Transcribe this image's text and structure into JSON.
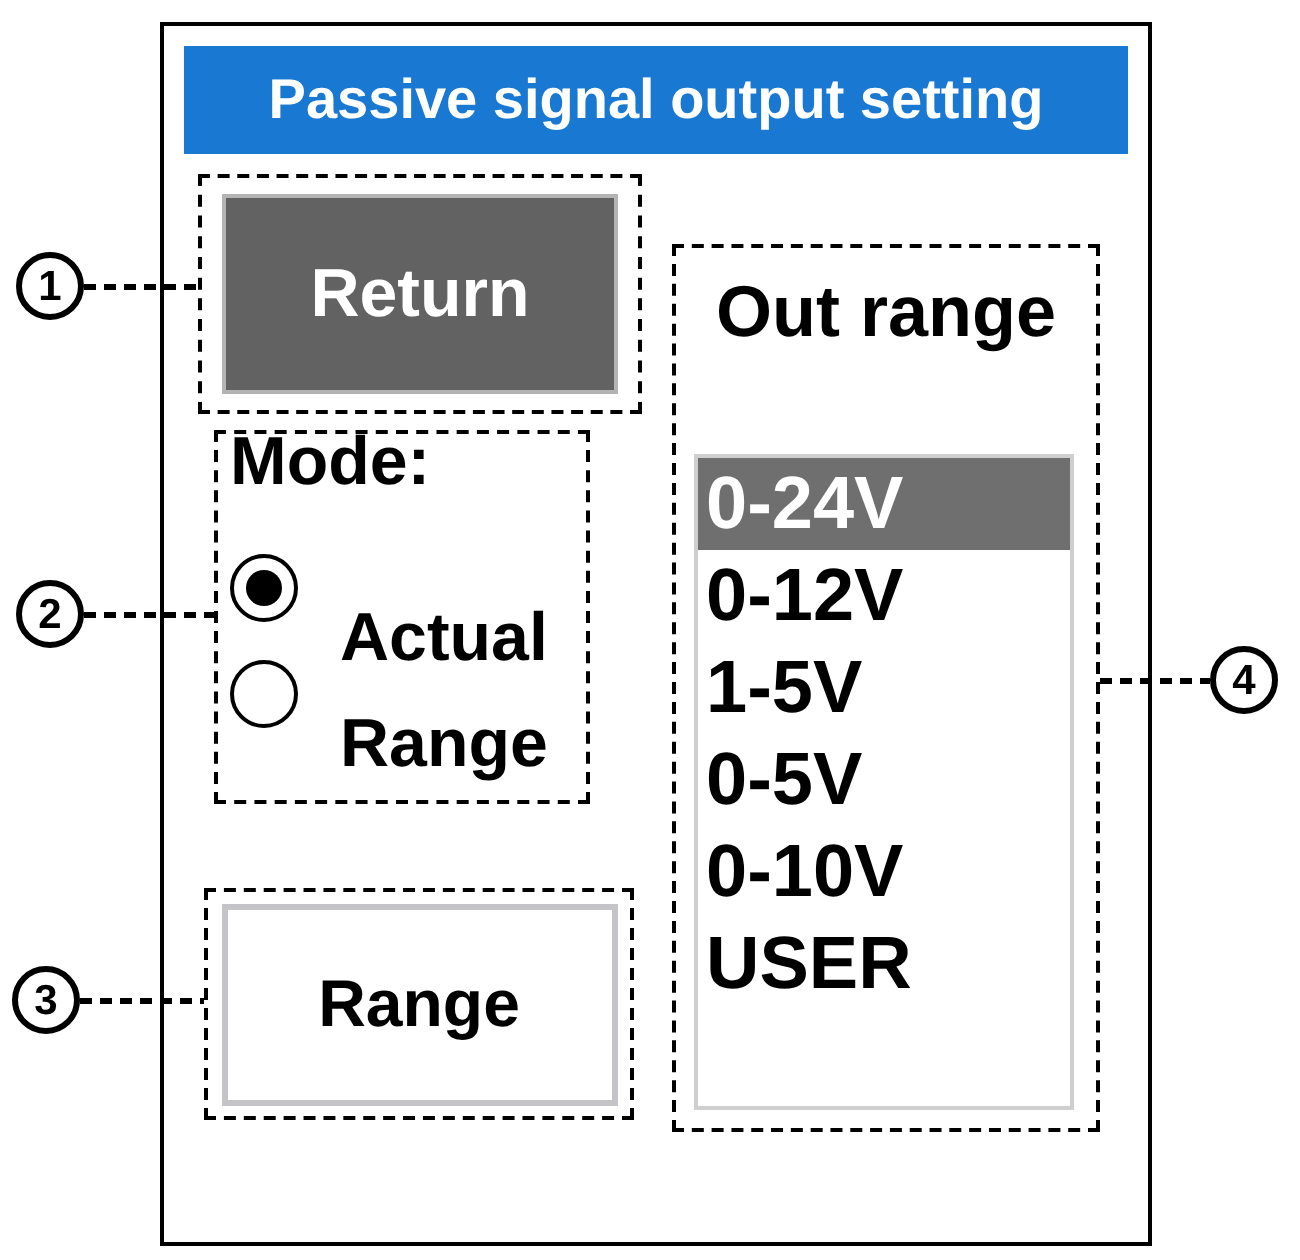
{
  "screen": {
    "title": "Passive signal output setting",
    "return_button": {
      "label": "Return"
    },
    "mode": {
      "label": "Mode:",
      "options": [
        {
          "label": "Actual",
          "selected": true
        },
        {
          "label": "Range",
          "selected": false
        }
      ]
    },
    "range_button": {
      "label": "Range"
    },
    "out_range": {
      "label": "Out range",
      "options": [
        {
          "label": "0-24V",
          "selected": true
        },
        {
          "label": "0-12V",
          "selected": false
        },
        {
          "label": "1-5V",
          "selected": false
        },
        {
          "label": "0-5V",
          "selected": false
        },
        {
          "label": "0-10V",
          "selected": false
        },
        {
          "label": "USER",
          "selected": false
        }
      ]
    }
  },
  "callouts": [
    {
      "label": "1"
    },
    {
      "label": "2"
    },
    {
      "label": "3"
    },
    {
      "label": "4"
    }
  ]
}
